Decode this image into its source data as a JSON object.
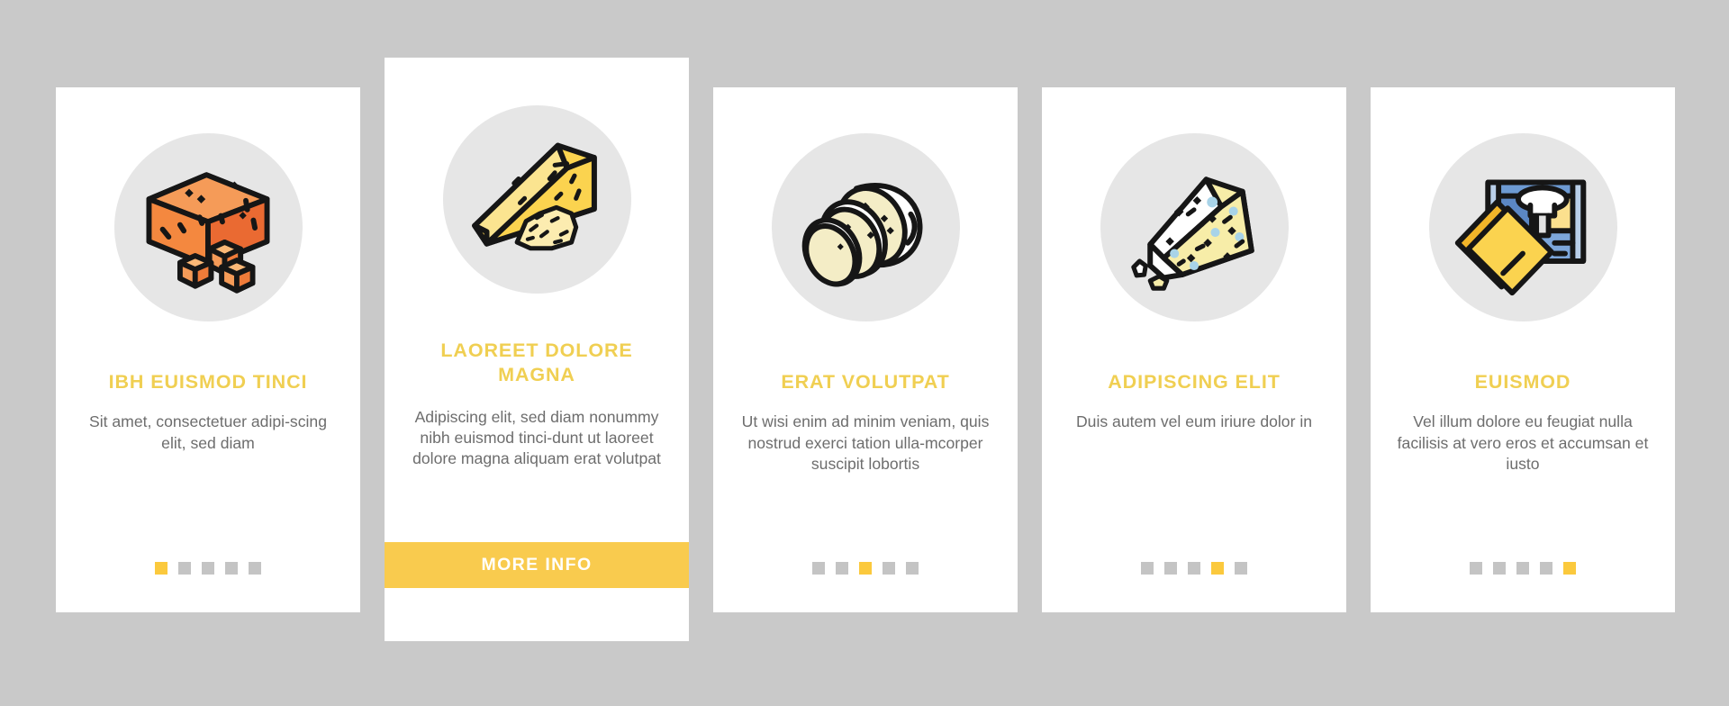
{
  "page": {
    "background_color": "#c9c9c9",
    "card_background": "#ffffff",
    "icon_circle_color": "#e6e6e6",
    "accent_color": "#f9cb4e",
    "title_color": "#f0cf52",
    "body_text_color": "#6d6d6d",
    "dot_inactive_color": "#c4c4c4",
    "dot_active_color": "#fbc93d"
  },
  "cards": [
    {
      "id": "card-1",
      "featured": false,
      "icon": "cheese-block-cubes-icon",
      "title": "IBH EUISMOD TINCI",
      "body": "Sit amet, consectetuer adipi-scing elit, sed diam",
      "dots": [
        true,
        false,
        false,
        false,
        false
      ],
      "dot_count": 5,
      "active_dot": 1
    },
    {
      "id": "card-2",
      "featured": true,
      "icon": "cheese-wedge-grated-icon",
      "title": "LAOREET DOLORE MAGNA",
      "body": "Adipiscing elit, sed diam nonummy nibh euismod tinci-dunt ut laoreet dolore magna aliquam erat volutpat",
      "button_label": "MORE INFO",
      "dots": [],
      "dot_count": 0,
      "active_dot": 2
    },
    {
      "id": "card-3",
      "featured": false,
      "icon": "sliced-mozzarella-icon",
      "title": "ERAT VOLUTPAT",
      "body": "Ut wisi enim ad minim veniam, quis nostrud exerci tation ulla-mcorper suscipit lobortis",
      "dots": [
        false,
        false,
        true,
        false,
        false
      ],
      "dot_count": 5,
      "active_dot": 3
    },
    {
      "id": "card-4",
      "featured": false,
      "icon": "blue-cheese-wedge-icon",
      "title": "ADIPISCING ELIT",
      "body": "Duis autem vel eum iriure dolor in",
      "dots": [
        false,
        false,
        false,
        true,
        false
      ],
      "dot_count": 5,
      "active_dot": 4
    },
    {
      "id": "card-5",
      "featured": false,
      "icon": "packaged-cheese-slices-icon",
      "title": "EUISMOD",
      "body": "Vel illum dolore eu feugiat nulla facilisis at vero eros et accumsan et iusto",
      "dots": [
        false,
        false,
        false,
        false,
        true
      ],
      "dot_count": 5,
      "active_dot": 5
    }
  ]
}
